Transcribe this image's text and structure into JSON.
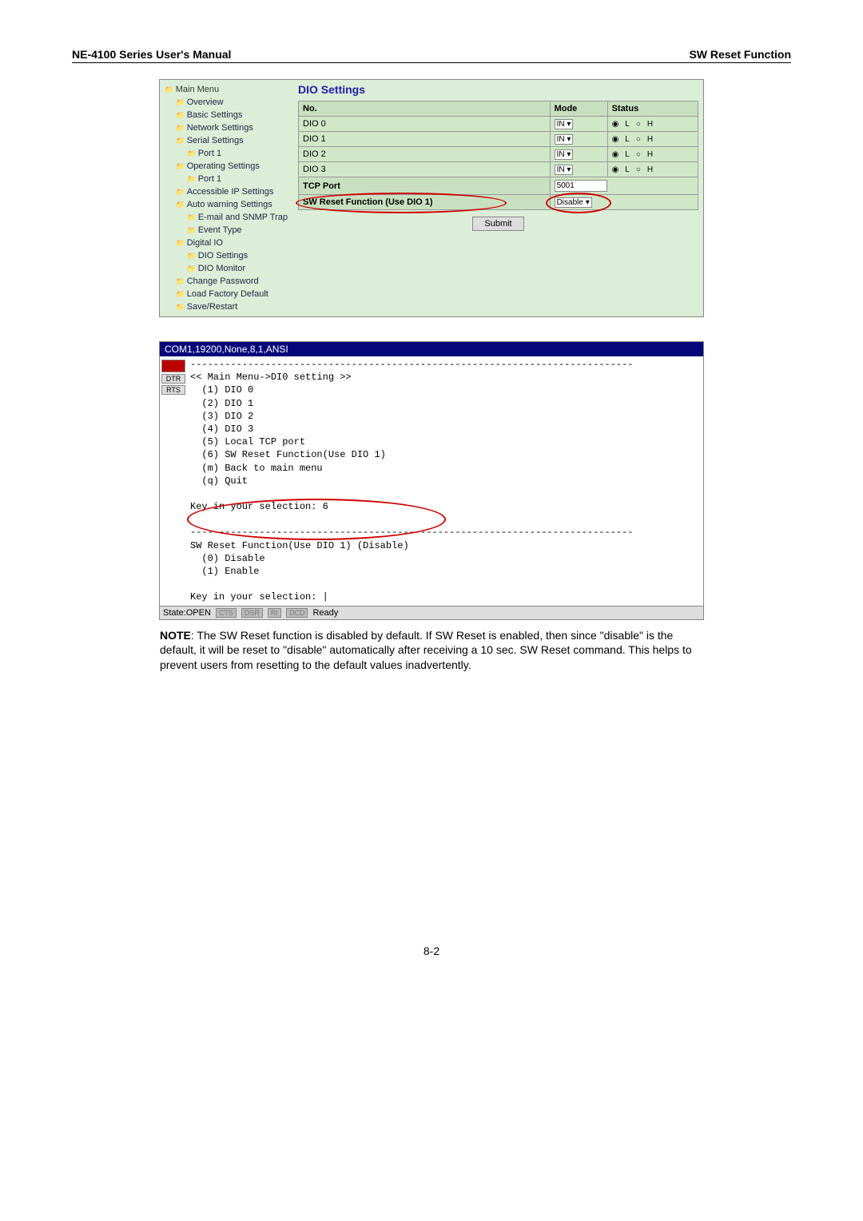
{
  "header": {
    "left": "NE-4100 Series User's Manual",
    "right": "SW Reset Function"
  },
  "nav": {
    "root": "Main Menu",
    "items": [
      "Overview",
      "Basic Settings",
      "Network Settings",
      "Serial Settings",
      "Port 1",
      "Operating Settings",
      "Port 1",
      "Accessible IP Settings",
      "Auto warning Settings",
      "E-mail and SNMP Trap",
      "Event Type",
      "Digital IO",
      "DIO Settings",
      "DIO Monitor",
      "Change Password",
      "Load Factory Default",
      "Save/Restart"
    ]
  },
  "dio": {
    "title": "DIO Settings",
    "cols": {
      "no": "No.",
      "mode": "Mode",
      "status": "Status"
    },
    "rows": [
      {
        "no": "DIO 0",
        "mode": "IN",
        "status": {
          "l": "L",
          "h": "H",
          "sel": "L"
        }
      },
      {
        "no": "DIO 1",
        "mode": "IN",
        "status": {
          "l": "L",
          "h": "H",
          "sel": "L"
        }
      },
      {
        "no": "DIO 2",
        "mode": "IN",
        "status": {
          "l": "L",
          "h": "H",
          "sel": "L"
        }
      },
      {
        "no": "DIO 3",
        "mode": "IN",
        "status": {
          "l": "L",
          "h": "H",
          "sel": "L"
        }
      }
    ],
    "tcp_label": "TCP Port",
    "tcp_value": "5001",
    "sw_label": "SW Reset Function (Use DIO 1)",
    "sw_value": "Disable",
    "submit": "Submit"
  },
  "terminal": {
    "title": "COM1,19200,None,8,1,ANSI",
    "side": [
      "",
      "DTR",
      "RTS"
    ],
    "lines": [
      "-----------------------------------------------------------------------------",
      "<< Main Menu->DI0 setting >>",
      "  (1) DIO 0",
      "  (2) DIO 1",
      "  (3) DIO 2",
      "  (4) DIO 3",
      "  (5) Local TCP port",
      "  (6) SW Reset Function(Use DIO 1)",
      "  (m) Back to main menu",
      "  (q) Quit",
      "",
      "Key in your selection: 6",
      "",
      "-----------------------------------------------------------------------------",
      "SW Reset Function(Use DIO 1) (Disable)",
      "  (0) Disable",
      "  (1) Enable",
      "",
      "Key in your selection: |"
    ],
    "status": {
      "state": "State:OPEN",
      "pills": [
        "CTS",
        "DSR",
        "RI",
        "DCD"
      ],
      "ready": "Ready"
    }
  },
  "note": {
    "prefix": "NOTE",
    "body": ": The SW Reset function is disabled by default. If SW Reset is enabled, then since \"disable\" is the default, it will be reset to \"disable\" automatically after receiving a 10 sec. SW Reset command. This helps to prevent users from resetting to the default values inadvertently."
  },
  "pagenum": "8-2"
}
